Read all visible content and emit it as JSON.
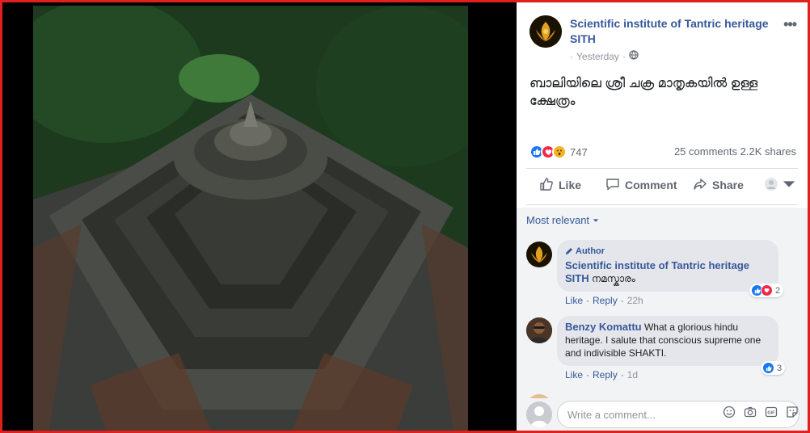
{
  "post": {
    "page_name": "Scientific institute of Tantric heritage SITH",
    "timestamp": "Yesterday",
    "text": "ബാലിയിലെ ശ്രീ ചക്ര മാതൃകയിൽ ഉള്ള ക്ഷേത്രം",
    "reaction_count": "747",
    "comments_count": "25 comments",
    "shares_count": "2.2K shares",
    "more_label": "•••"
  },
  "actions": {
    "like": "Like",
    "comment": "Comment",
    "share": "Share"
  },
  "comments_section": {
    "sort_label": "Most relevant",
    "comments": [
      {
        "author_badge": "Author",
        "name": "Scientific institute of Tantric heritage SITH",
        "text": "നമസ്കാരം",
        "reactions": "2",
        "like": "Like",
        "reply": "Reply",
        "time": "22h"
      },
      {
        "name": "Benzy Komattu",
        "text": "What a glorious hindu heritage. I salute that conscious supreme one and indivisible SHAKTI.",
        "reactions": "3",
        "like": "Like",
        "reply": "Reply",
        "time": "1d"
      }
    ],
    "write_placeholder": "Write a comment..."
  },
  "colors": {
    "frame": "#e0201c",
    "link": "#365899",
    "like": "#1877f2",
    "love": "#f0284a",
    "wow": "#f7b125"
  }
}
